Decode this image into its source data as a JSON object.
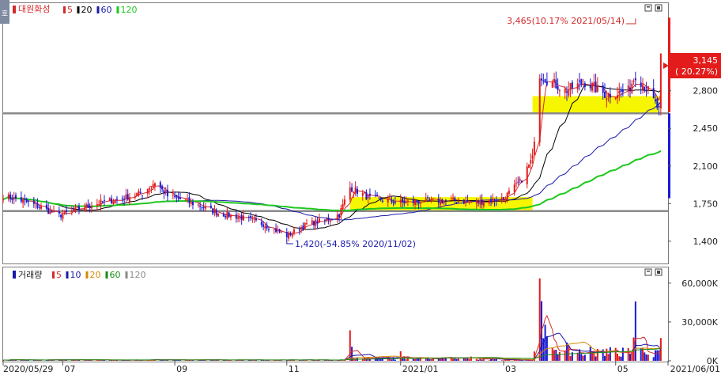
{
  "stock": {
    "name": "대원화성",
    "side_tag": "호",
    "price_legend": [
      {
        "label": "5",
        "color": "#d42a2a"
      },
      {
        "label": "20",
        "color": "#000000"
      },
      {
        "label": "60",
        "color": "#1a1aa8"
      },
      {
        "label": "120",
        "color": "#1ec81e"
      }
    ],
    "volume_title": "거래량",
    "volume_legend": [
      {
        "label": "5",
        "color": "#d42a2a"
      },
      {
        "label": "10",
        "color": "#1a1aa8"
      },
      {
        "label": "20",
        "color": "#d48a00"
      },
      {
        "label": "60",
        "color": "#1a8a1a"
      },
      {
        "label": "120",
        "color": "#8a8a8a"
      }
    ],
    "current_price": "3,145",
    "current_change": "( 20.27%)",
    "high_annotation": "3,465(10.17% 2021/05/14)",
    "low_annotation": "1,420(-54.85% 2020/11/02)"
  },
  "chart_data": {
    "type": "candlestick",
    "x_start_date": "2020/05/29",
    "x_end_date": "2021/06/01",
    "x_tick_labels": [
      "2020/05/29",
      "07",
      "09",
      "11",
      "2021/01",
      "03",
      "05",
      "2021/06/01"
    ],
    "price_axis": {
      "ylim": [
        1200,
        3600
      ],
      "ticks": [
        "1,400",
        "1,750",
        "2,100",
        "2,450",
        "2,800"
      ],
      "tick_values": [
        1400,
        1750,
        2100,
        2450,
        2800
      ]
    },
    "volume_axis": {
      "ylim": [
        0,
        66000
      ],
      "ticks": [
        "0K",
        "30,000K",
        "60,000K"
      ],
      "tick_values": [
        0,
        30000,
        60000
      ]
    },
    "support_lines": [
      1680,
      2590
    ],
    "highlight_zones": [
      {
        "x_start": "2020/12/07",
        "x_end": "2021/03/18",
        "price_low": 1680,
        "price_high": 1810
      },
      {
        "x_start": "2021/03/18",
        "x_end": "2021/05/27",
        "price_low": 2590,
        "price_high": 2750
      }
    ],
    "price_anchors": [
      [
        "2020/05/29",
        1820
      ],
      [
        "2020/06/08",
        1780
      ],
      [
        "2020/06/18",
        1720
      ],
      [
        "2020/06/29",
        1640
      ],
      [
        "2020/07/10",
        1700
      ],
      [
        "2020/07/22",
        1760
      ],
      [
        "2020/08/03",
        1800
      ],
      [
        "2020/08/14",
        1850
      ],
      [
        "2020/08/21",
        1950
      ],
      [
        "2020/08/28",
        1820
      ],
      [
        "2020/09/04",
        1790
      ],
      [
        "2020/09/15",
        1730
      ],
      [
        "2020/09/25",
        1660
      ],
      [
        "2020/10/08",
        1620
      ],
      [
        "2020/10/20",
        1560
      ],
      [
        "2020/11/02",
        1450
      ],
      [
        "2020/11/13",
        1560
      ],
      [
        "2020/11/24",
        1600
      ],
      [
        "2020/12/01",
        1650
      ],
      [
        "2020/12/07",
        1900
      ],
      [
        "2020/12/18",
        1800
      ],
      [
        "2021/01/04",
        1760
      ],
      [
        "2021/01/18",
        1770
      ],
      [
        "2021/02/01",
        1780
      ],
      [
        "2021/02/15",
        1760
      ],
      [
        "2021/03/02",
        1800
      ],
      [
        "2021/03/11",
        1950
      ],
      [
        "2021/03/18",
        2170
      ],
      [
        "2021/03/22",
        2950
      ],
      [
        "2021/04/05",
        2800
      ],
      [
        "2021/04/16",
        2880
      ],
      [
        "2021/04/28",
        2760
      ],
      [
        "2021/05/10",
        2800
      ],
      [
        "2021/05/14",
        2950
      ],
      [
        "2021/05/21",
        2800
      ],
      [
        "2021/05/27",
        2615
      ],
      [
        "2021/05/28",
        3145
      ]
    ],
    "volume_spikes": [
      [
        "2020/12/07",
        22000
      ],
      [
        "2021/01/04",
        6000
      ],
      [
        "2021/03/22",
        60000
      ],
      [
        "2021/03/23",
        38000
      ],
      [
        "2021/03/25",
        24000
      ],
      [
        "2021/04/06",
        12000
      ],
      [
        "2021/05/14",
        36000
      ],
      [
        "2021/05/28",
        14000
      ]
    ],
    "last_price": 3145
  }
}
